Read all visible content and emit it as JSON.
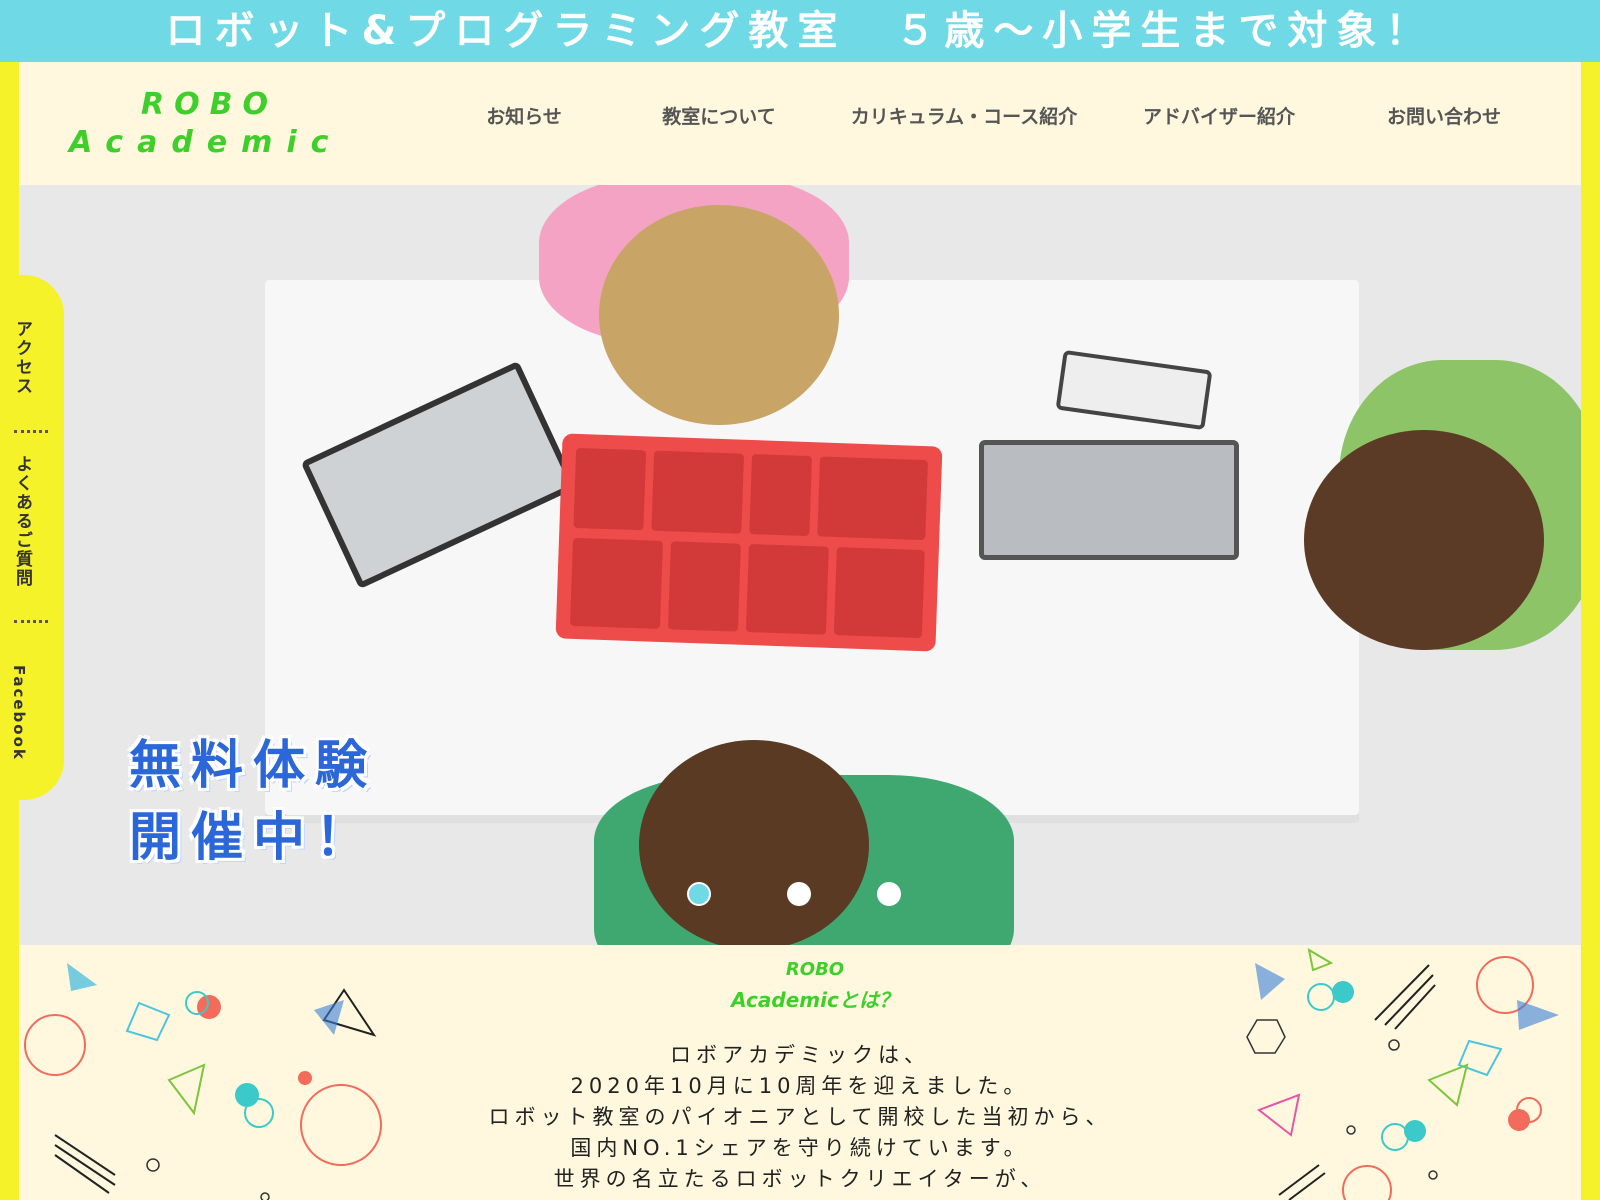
{
  "banner": {
    "text": "ロボット&プログラミング教室　５歳～小学生まで対象！"
  },
  "logo": {
    "line1": "ROBO",
    "line2": "Academic"
  },
  "nav": [
    {
      "label": "お知らせ"
    },
    {
      "label": "教室について"
    },
    {
      "label": "カリキュラム・コース紹介"
    },
    {
      "label": "アドバイザー紹介"
    },
    {
      "label": "お問い合わせ"
    }
  ],
  "side_menu": [
    {
      "label": "アクセス"
    },
    {
      "label": "よくあるご質問"
    },
    {
      "label": "Facebook"
    }
  ],
  "hero": {
    "promo_line1": "無料体験",
    "promo_line2": "開催中！",
    "slides": 3,
    "active_slide": 1
  },
  "about": {
    "title_line1": "ROBO",
    "title_line2": "Academicとは？",
    "lines": [
      "ロボアカデミックは、",
      "2020年10月に10周年を迎えました。",
      "ロボット教室のパイオニアとして開校した当初から、",
      "国内NO.1シェアを守り続けています。",
      "世界の名立たるロボットクリエイターが、"
    ]
  },
  "colors": {
    "accent_cyan": "#6fd9e6",
    "frame_yellow": "#f5f22a",
    "logo_green": "#3fcf2a",
    "promo_blue": "#2b67d9",
    "cream": "#fff8de"
  }
}
